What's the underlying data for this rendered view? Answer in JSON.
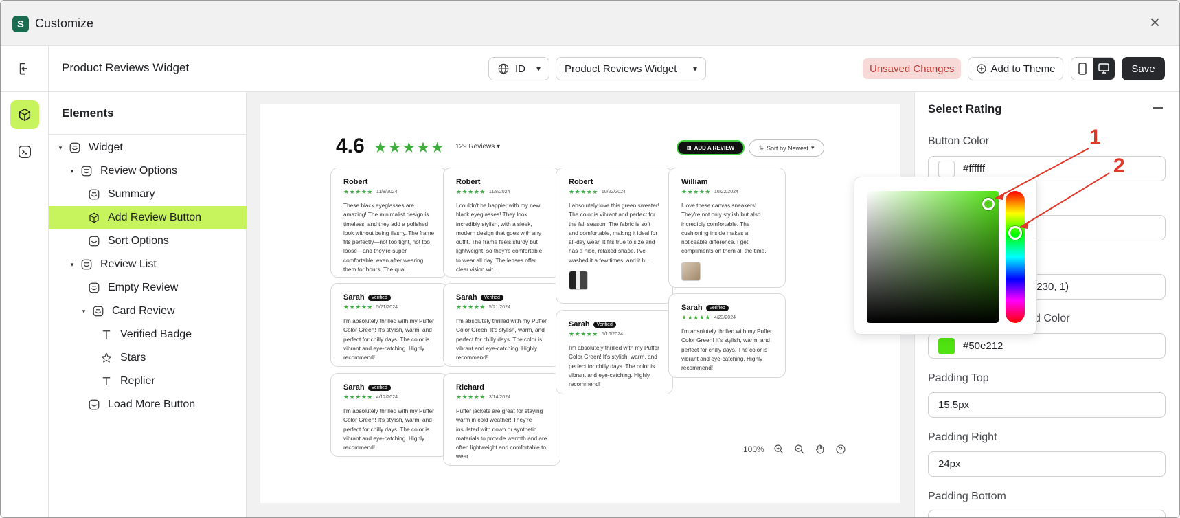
{
  "window": {
    "title": "Customize",
    "close_label": "×"
  },
  "toolbar": {
    "page_name": "Product Reviews Widget",
    "language": "ID",
    "widget_select": "Product Reviews Widget",
    "unsaved": "Unsaved Changes",
    "add_to_theme": "Add to Theme",
    "save": "Save"
  },
  "elements_panel": {
    "title": "Elements",
    "items": [
      {
        "label": "Widget"
      },
      {
        "label": "Review Options"
      },
      {
        "label": "Summary"
      },
      {
        "label": "Add Review Button"
      },
      {
        "label": "Sort Options"
      },
      {
        "label": "Review List"
      },
      {
        "label": "Empty Review"
      },
      {
        "label": "Card Review"
      },
      {
        "label": "Verified Badge"
      },
      {
        "label": "Stars"
      },
      {
        "label": "Replier"
      },
      {
        "label": "Load More Button"
      }
    ]
  },
  "preview": {
    "score": "4.6",
    "stars": "★★★★★",
    "review_count": "129 Reviews",
    "add_review": "ADD A REVIEW",
    "sort": "Sort by Newest",
    "cards": [
      {
        "name": "Robert",
        "stars": "★★★★★",
        "date": "11/8/2024",
        "verified": "",
        "text": "These black eyeglasses are amazing! The minimalist design is timeless, and they add a polished look without being flashy. The frame fits perfectly—not too tight, not too loose—and they're super comfortable, even after wearing them for hours. The qual..."
      },
      {
        "name": "Robert",
        "stars": "★★★★★",
        "date": "11/8/2024",
        "verified": "",
        "text": "I couldn't be happier with my new black eyeglasses! They look incredibly stylish, with a sleek, modern design that goes with any outfit. The frame feels sturdy but lightweight, so they're comfortable to wear all day. The lenses offer clear vision wit..."
      },
      {
        "name": "Robert",
        "stars": "★★★★★",
        "date": "10/22/2024",
        "verified": "",
        "text": "I absolutely love this green sweater! The color is vibrant and perfect for the fall season. The fabric is soft and comfortable, making it ideal for all-day wear. It fits true to size and has a nice, relaxed shape. I've washed it a few times, and it h..."
      },
      {
        "name": "William",
        "stars": "★★★★★",
        "date": "10/22/2024",
        "verified": "",
        "text": "I love these canvas sneakers! They're not only stylish but also incredibly comfortable. The cushioning inside makes a noticeable difference. I get compliments on them all the time."
      },
      {
        "name": "Sarah",
        "stars": "★★★★★",
        "date": "5/21/2024",
        "verified": "Verified",
        "text": "I'm absolutely thrilled with my Puffer Color Green! It's stylish, warm, and perfect for chilly days. The color is vibrant and eye-catching. Highly recommend!"
      },
      {
        "name": "Sarah",
        "stars": "★★★★★",
        "date": "5/21/2024",
        "verified": "Verified",
        "text": "I'm absolutely thrilled with my Puffer Color Green! It's stylish, warm, and perfect for chilly days. The color is vibrant and eye-catching. Highly recommend!"
      },
      {
        "name": "Sarah",
        "stars": "★★★★★",
        "date": "5/10/2024",
        "verified": "Verified",
        "text": "I'm absolutely thrilled with my Puffer Color Green! It's stylish, warm, and perfect for chilly days. The color is vibrant and eye-catching. Highly recommend!"
      },
      {
        "name": "Sarah",
        "stars": "★★★★★",
        "date": "4/23/2024",
        "verified": "Verified",
        "text": "I'm absolutely thrilled with my Puffer Color Green! It's stylish, warm, and perfect for chilly days. The color is vibrant and eye-catching. Highly recommend!"
      },
      {
        "name": "Sarah",
        "stars": "★★★★★",
        "date": "4/12/2024",
        "verified": "Verified",
        "text": "I'm absolutely thrilled with my Puffer Color Green! It's stylish, warm, and perfect for chilly days. The color is vibrant and eye-catching. Highly recommend!"
      },
      {
        "name": "Richard",
        "stars": "★★★★★",
        "date": "3/14/2024",
        "verified": "",
        "text": "Puffer jackets are great for staying warm in cold weather! They're insulated with down or synthetic materials to provide warmth and are often lightweight and comfortable to wear"
      }
    ],
    "zoom": "100%"
  },
  "right_panel": {
    "title": "Select Rating",
    "button_color_label": "Button Color",
    "button_color_value": "#ffffff",
    "partial_value": "230, 1)",
    "partial_label": "d Color",
    "bg_color_value": "#50e212",
    "padding_top_label": "Padding Top",
    "padding_top_value": "15.5px",
    "padding_right_label": "Padding Right",
    "padding_right_value": "24px",
    "padding_bottom_label": "Padding Bottom"
  },
  "annotations": {
    "one": "1",
    "two": "2"
  },
  "colors": {
    "accent": "#c7f45c",
    "star": "#3fae3f",
    "picker_hue": "#50e212",
    "annotation": "#e0392b",
    "unsaved_bg": "#f8d9d8"
  }
}
